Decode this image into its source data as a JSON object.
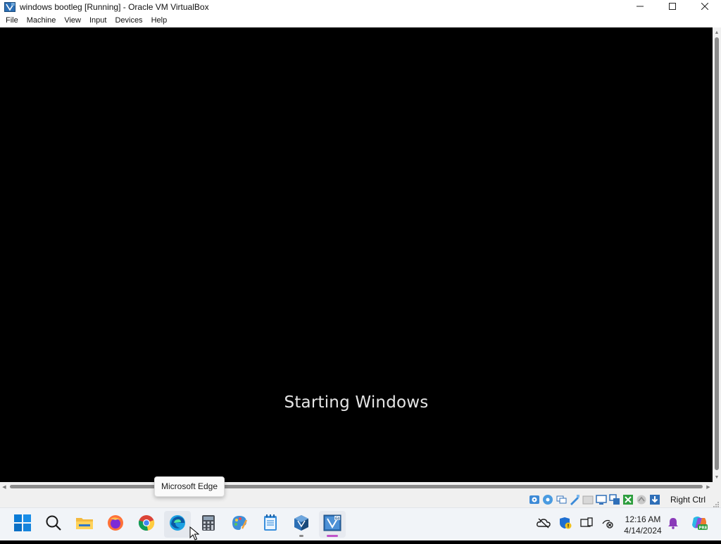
{
  "window": {
    "title": "windows bootleg [Running] - Oracle VM VirtualBox",
    "app_icon": "virtualbox-vm-icon",
    "controls": [
      "minimize-icon",
      "maximize-icon",
      "close-icon"
    ]
  },
  "menubar": {
    "items": [
      {
        "label": "File"
      },
      {
        "label": "Machine"
      },
      {
        "label": "View"
      },
      {
        "label": "Input"
      },
      {
        "label": "Devices"
      },
      {
        "label": "Help"
      }
    ]
  },
  "vm_screen": {
    "boot_message": "Starting Windows",
    "background": "#000000"
  },
  "statusbar": {
    "indicators": [
      "hard-disk-icon",
      "optical-drive-icon",
      "audio-icon",
      "network-icon",
      "usb-icon",
      "shared-folders-icon",
      "display-icon",
      "video-capture-icon",
      "cpu-icon",
      "mouse-integration-icon",
      "keyboard-icon"
    ],
    "host_key": "Right Ctrl"
  },
  "tooltip": {
    "text": "Microsoft Edge"
  },
  "taskbar": {
    "apps": [
      {
        "name": "start-button",
        "icon": "windows-start-icon"
      },
      {
        "name": "search-button",
        "icon": "search-icon"
      },
      {
        "name": "file-explorer",
        "icon": "folder-icon"
      },
      {
        "name": "firefox",
        "icon": "firefox-icon"
      },
      {
        "name": "chrome",
        "icon": "chrome-icon"
      },
      {
        "name": "microsoft-edge",
        "icon": "edge-icon",
        "hovered": true
      },
      {
        "name": "calculator",
        "icon": "calculator-icon"
      },
      {
        "name": "paint",
        "icon": "paint-icon"
      },
      {
        "name": "notepad",
        "icon": "notepad-icon"
      },
      {
        "name": "virtualbox-manager",
        "icon": "virtualbox-icon",
        "running": true
      },
      {
        "name": "virtualbox-vm",
        "icon": "virtualbox-vm-icon",
        "active": true
      }
    ],
    "tray": {
      "icons": [
        "onedrive-offline-icon",
        "security-shield-warning-icon",
        "display-icon",
        "network-disconnected-icon"
      ],
      "time": "12:16 AM",
      "date": "4/14/2024",
      "notification_icon": "bell-icon",
      "copilot_icon": "copilot-pre-icon"
    }
  },
  "colors": {
    "accent": "#0067c0",
    "active_indicator": "#c054c9",
    "taskbar_bg": "#f1f4f8"
  }
}
